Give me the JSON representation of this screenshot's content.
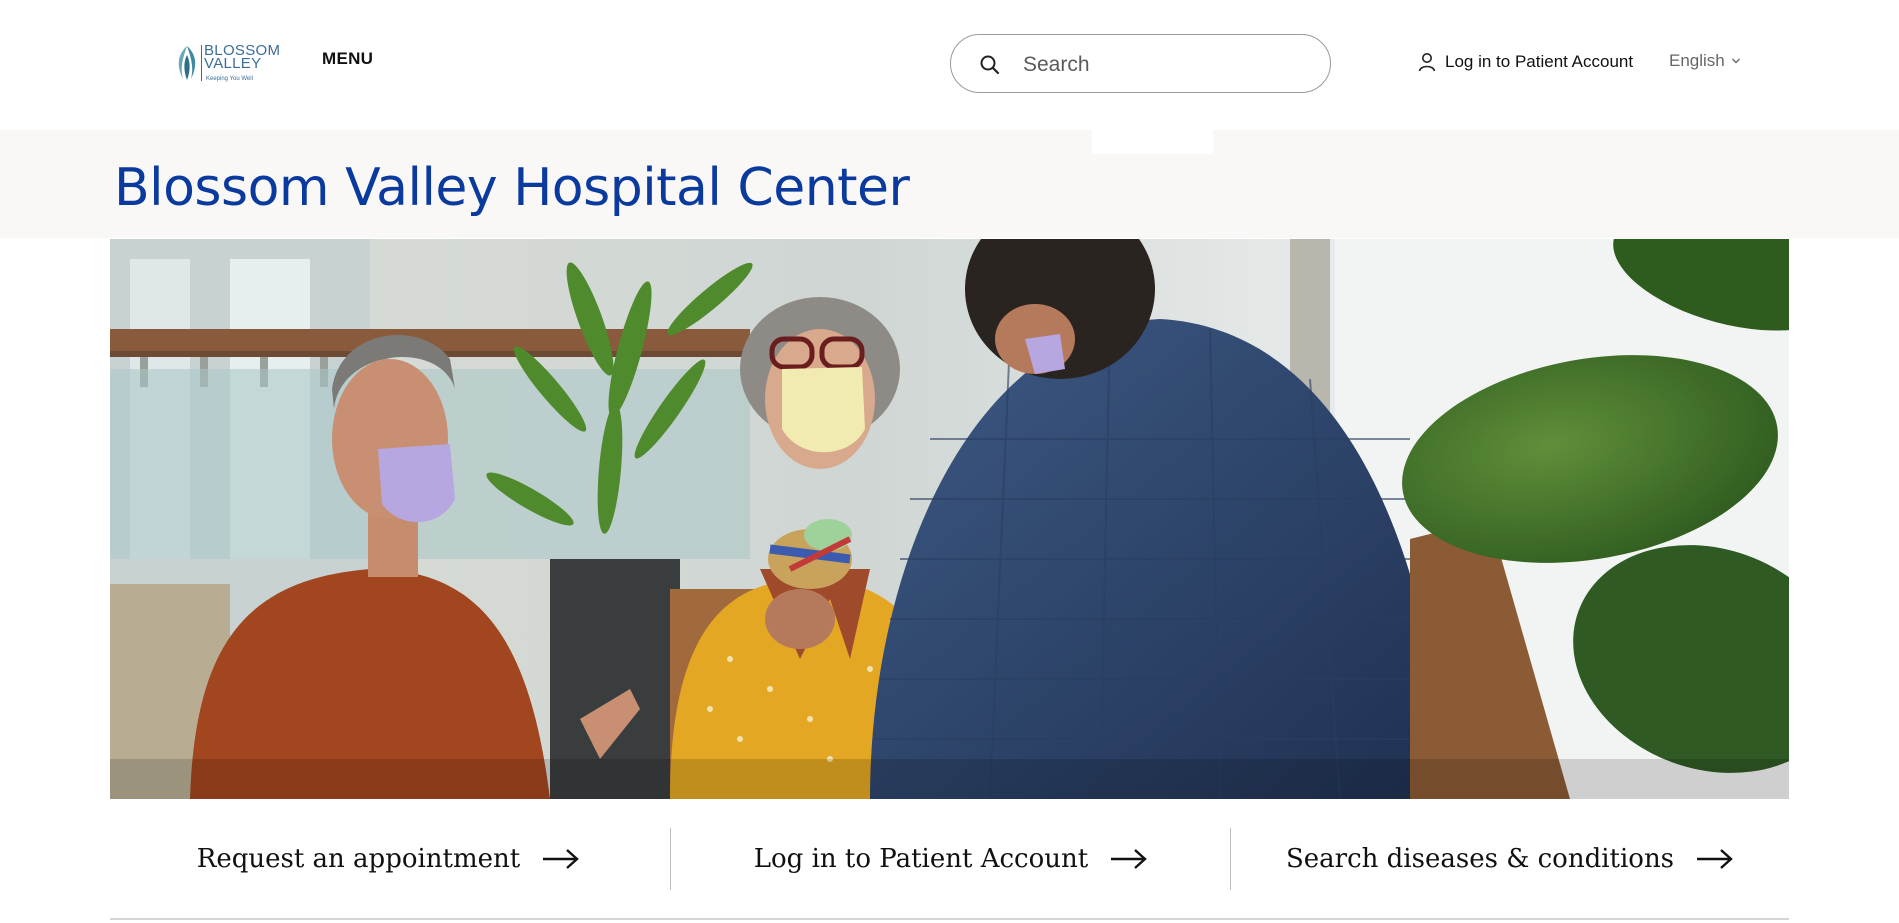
{
  "header": {
    "logo": {
      "line1": "BLOSSOM",
      "line2": "VALLEY",
      "tagline": "Keeping You Well",
      "icon": "blossom-leaf-logo"
    },
    "menu_label": "MENU",
    "search": {
      "placeholder": "Search",
      "value": "",
      "icon": "search-icon"
    },
    "login_label": "Log in to Patient Account",
    "login_icon": "user-icon",
    "language": {
      "selected": "English",
      "icon": "chevron-down-icon"
    }
  },
  "page": {
    "title": "Blossom Valley Hospital Center"
  },
  "quick_links": [
    {
      "label": "Request an appointment",
      "icon": "arrow-right-icon"
    },
    {
      "label": "Log in to Patient Account",
      "icon": "arrow-right-icon"
    },
    {
      "label": "Search diseases & conditions",
      "icon": "arrow-right-icon"
    }
  ],
  "colors": {
    "brand_blue": "#0a3a9e",
    "logo_teal": "#3a6d9a",
    "band_bg": "#f9f8f6"
  }
}
